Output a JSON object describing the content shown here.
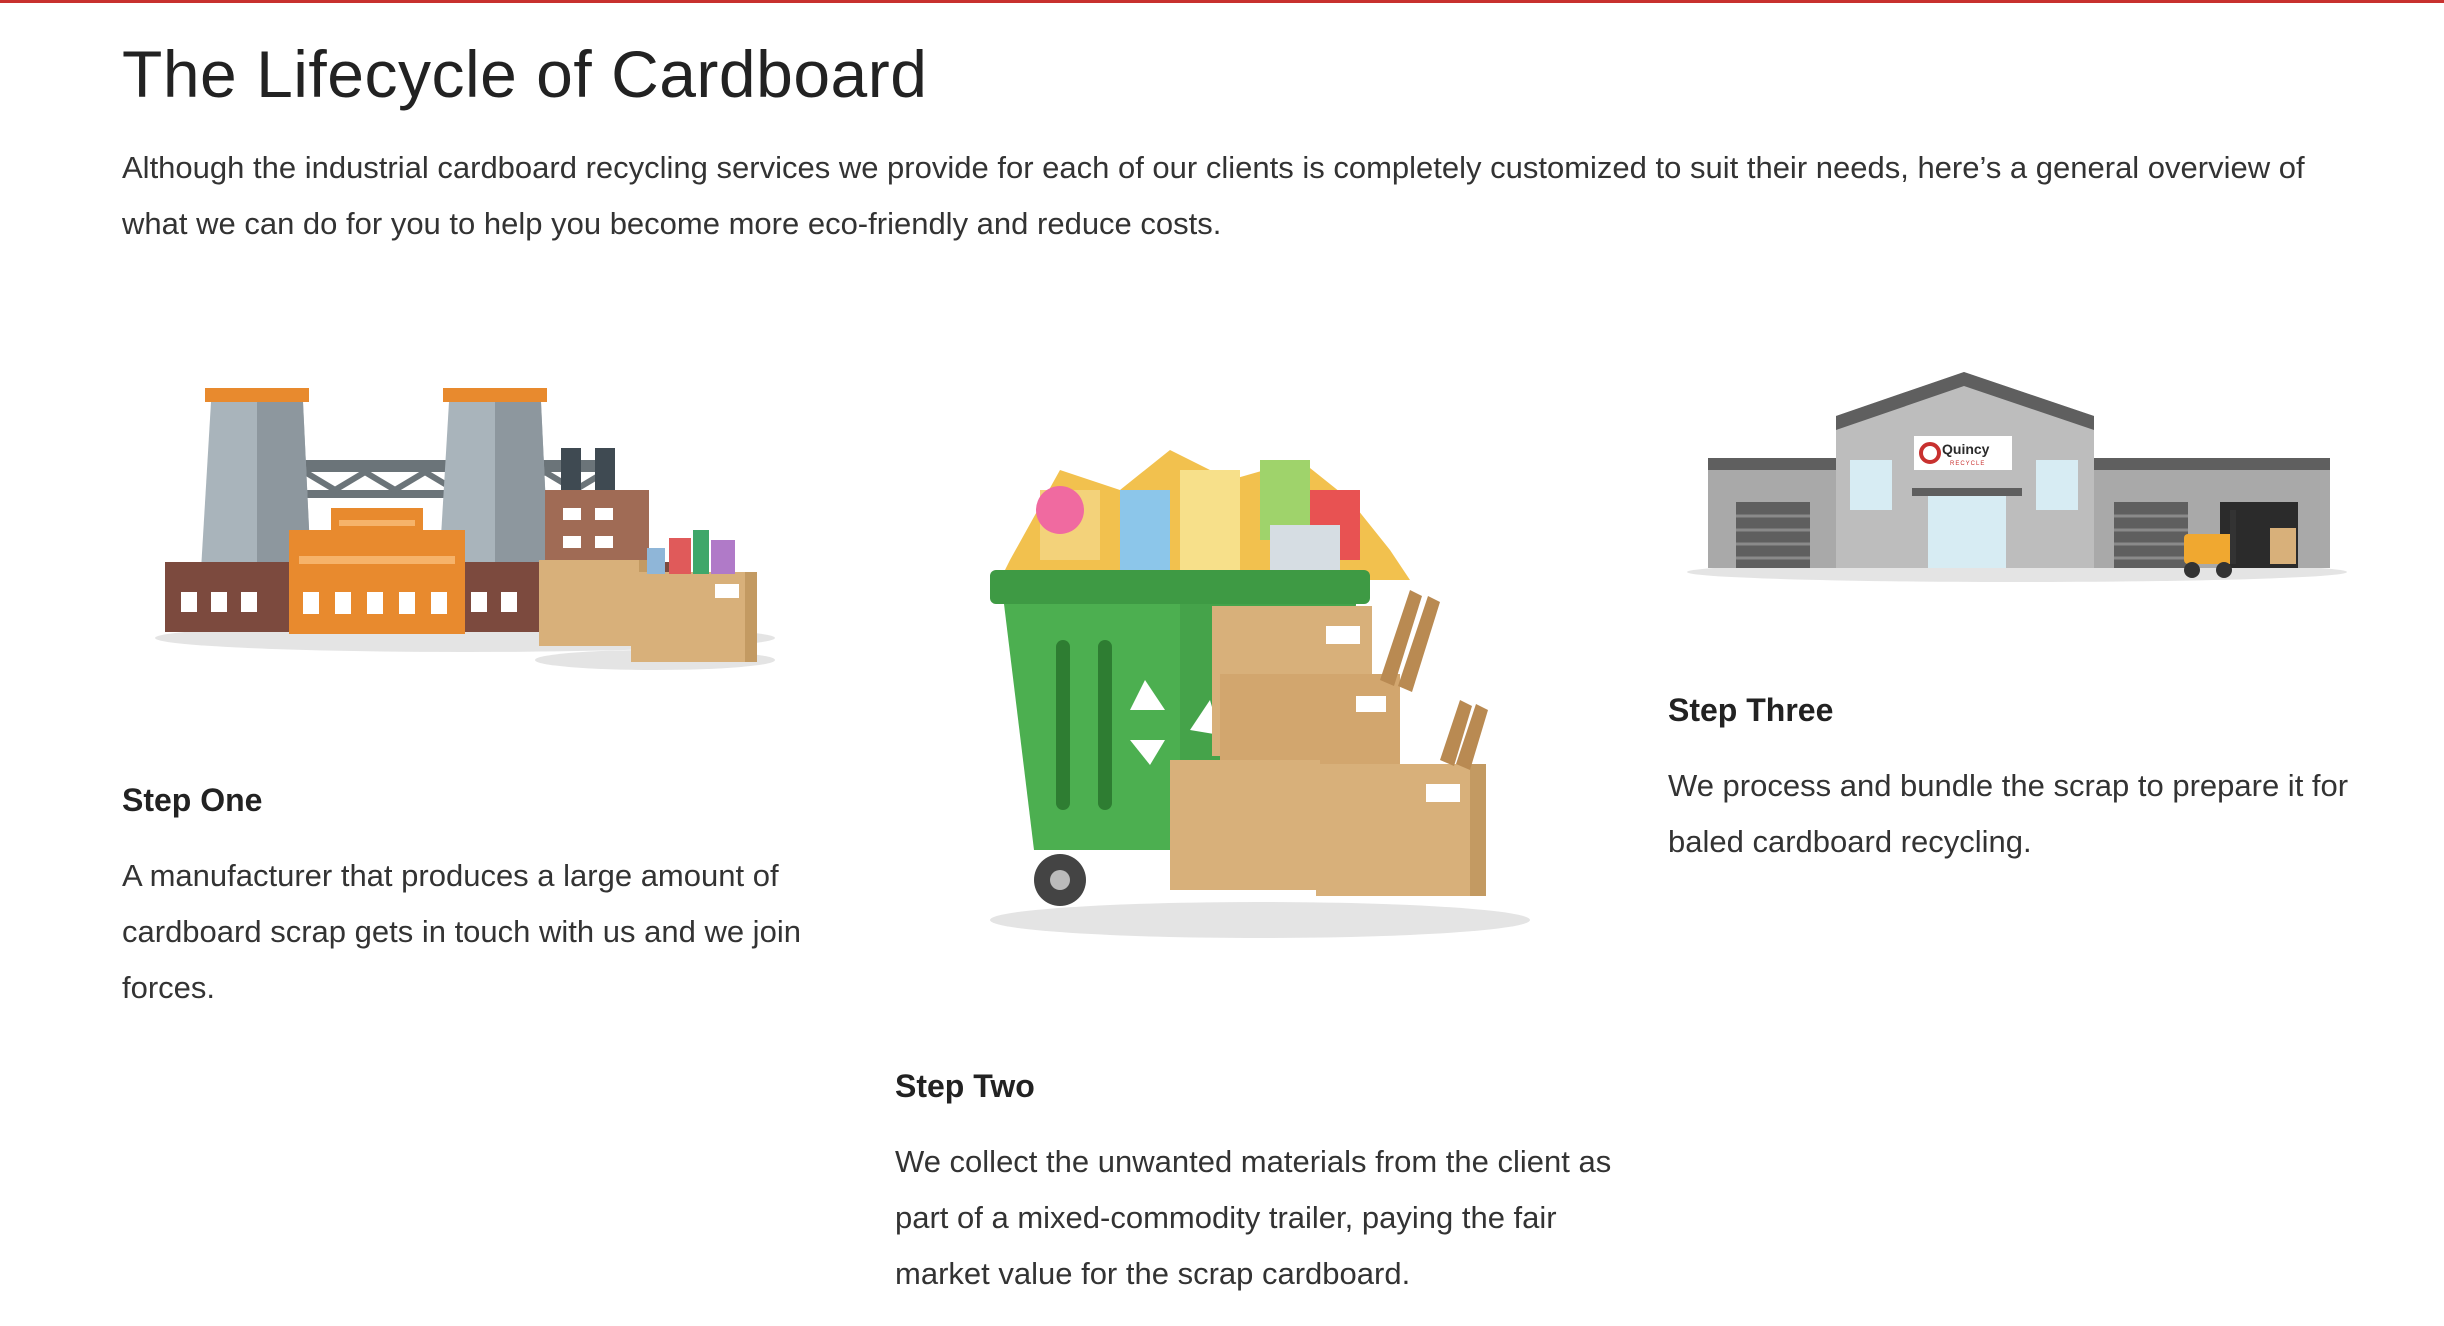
{
  "page": {
    "title": "The Lifecycle of Cardboard",
    "intro": "Although the industrial cardboard recycling services we provide for each of our clients is completely customized to suit their needs, here’s a general overview of what we can do for you to help you become more eco-friendly and reduce costs."
  },
  "steps": [
    {
      "title": "Step One",
      "text": "A manufacturer that produces a large amount of cardboard scrap gets in touch with us and we join forces."
    },
    {
      "title": "Step Two",
      "text": "We collect the unwanted materials from the client as part of a mixed-commodity trailer, paying the fair market value for the scrap cardboard."
    },
    {
      "title": "Step Three",
      "text": "We process and bundle the scrap to prepare it for baled cardboard recycling."
    }
  ],
  "illustrations": {
    "factory": "factory-icon",
    "bin": "recycling-bin-icon",
    "warehouse": "warehouse-icon",
    "warehouse_sign": "Quincy",
    "warehouse_sign_sub": "RECYCLE"
  },
  "colors": {
    "accent_rule": "#c8312f",
    "orange": "#e88a2e",
    "bin_green": "#4caf50",
    "cardboard": "#d8b07a"
  }
}
